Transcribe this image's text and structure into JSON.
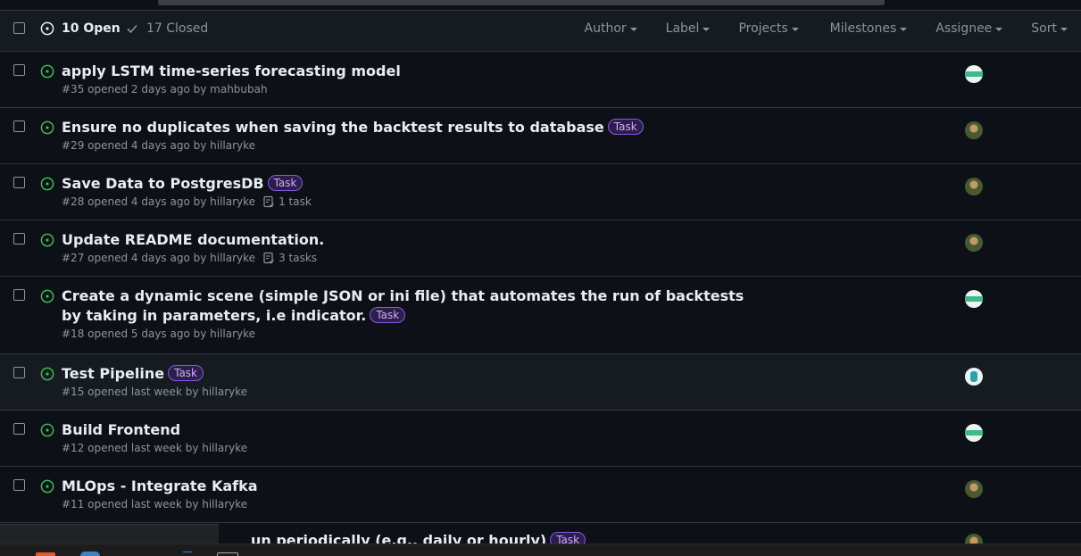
{
  "header": {
    "open_label": "10 Open",
    "closed_label": "17 Closed",
    "filters": [
      "Author",
      "Label",
      "Projects",
      "Milestones",
      "Assignee",
      "Sort"
    ]
  },
  "issues": [
    {
      "title": "apply LSTM time-series forecasting model",
      "label": "",
      "meta": "#35 opened 2 days ago by mahbubah",
      "tasks": "",
      "avatar": "green"
    },
    {
      "title": "Ensure no duplicates when saving the backtest results to database",
      "label": "Task",
      "meta": "#29 opened 4 days ago by hillaryke",
      "tasks": "",
      "avatar": "photo"
    },
    {
      "title": "Save Data to PostgresDB",
      "label": "Task",
      "meta": "#28 opened 4 days ago by hillaryke",
      "tasks": "1 task",
      "avatar": "photo"
    },
    {
      "title": "Update README documentation.",
      "label": "",
      "meta": "#27 opened 4 days ago by hillaryke",
      "tasks": "3 tasks",
      "avatar": "photo"
    },
    {
      "title": "Create a dynamic scene (simple JSON or ini file) that automates the run of backtests by taking in parameters, i.e indicator.",
      "label": "Task",
      "meta": "#18 opened 5 days ago by hillaryke",
      "tasks": "",
      "avatar": "green"
    },
    {
      "title": "Test Pipeline",
      "label": "Task",
      "meta": "#15 opened last week by hillaryke",
      "tasks": "",
      "avatar": "teal"
    },
    {
      "title": "Build Frontend",
      "label": "",
      "meta": "#12 opened last week by hillaryke",
      "tasks": "",
      "avatar": "green"
    },
    {
      "title": "MLOps - Integrate Kafka",
      "label": "",
      "meta": "#11 opened last week by hillaryke",
      "tasks": "",
      "avatar": "photo"
    },
    {
      "title": "un periodically (e.g., daily or hourly)",
      "label": "Task",
      "meta": "",
      "tasks": "",
      "avatar": "photo"
    }
  ]
}
